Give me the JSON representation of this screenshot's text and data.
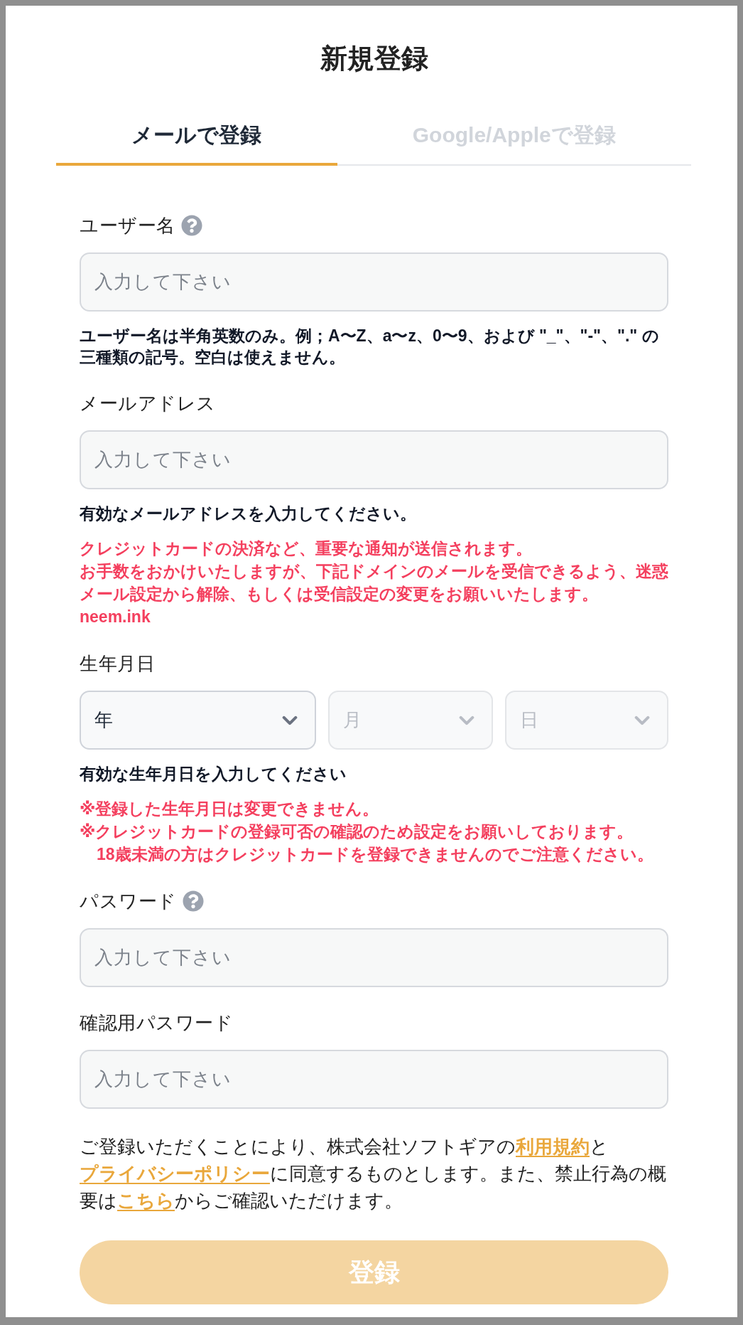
{
  "title": "新規登録",
  "tabs": [
    {
      "label": "メールで登録",
      "selected": true
    },
    {
      "label": "Google/Appleで登録",
      "selected": false
    }
  ],
  "form": {
    "fields": [
      {
        "kind": "text",
        "label": "ユーザー名",
        "help": true,
        "placeholder": "入力して下さい",
        "hint": "ユーザー名は半角英数のみ。例；A〜Z、a〜z、0〜9、および \"_\"、\"-\"、\".\" の三種類の記号。空白は使えません。"
      },
      {
        "kind": "text",
        "label": "メールアドレス",
        "help": false,
        "placeholder": "入力して下さい",
        "hint": "有効なメールアドレスを入力してください。",
        "notes": [
          {
            "text": "クレジットカードの決済など、重要な通知が送信されます。",
            "kind": "note"
          },
          {
            "text": "お手数をおかけいたしますが、下記ドメインのメールを受信できるよう、迷惑メール設定から解除、もしくは受信設定の変更をお願いいたします。",
            "kind": "note"
          },
          {
            "text": "neem.ink",
            "kind": "note"
          }
        ]
      },
      {
        "kind": "date",
        "label": "生年月日",
        "help": false,
        "selects": [
          {
            "value": "年",
            "disabled": false
          },
          {
            "value": "月",
            "disabled": true
          },
          {
            "value": "日",
            "disabled": true
          }
        ],
        "hint": "有効な生年月日を入力してください",
        "notes": [
          {
            "text": "※登録した生年月日は変更できません。",
            "kind": "note"
          },
          {
            "text": "※クレジットカードの登録可否の確認のため設定をお願いしております。",
            "kind": "note"
          },
          {
            "text": "18歳未満の方はクレジットカードを登録できませんのでご注意ください。",
            "kind": "continuation"
          }
        ]
      },
      {
        "kind": "text",
        "label": "パスワード",
        "help": true,
        "placeholder": "入力して下さい"
      },
      {
        "kind": "text",
        "label": "確認用パスワード",
        "help": false,
        "placeholder": "入力して下さい"
      }
    ]
  },
  "consent": [
    {
      "kind": "text",
      "text": "ご登録いただくことにより、株式会社ソフトギアの"
    },
    {
      "kind": "link",
      "text": "利用規約"
    },
    {
      "kind": "text",
      "text": "と"
    },
    {
      "kind": "link",
      "text": "プライバシーポリシー"
    },
    {
      "kind": "text",
      "text": "に同意するものとします。また、禁止行為の概要は"
    },
    {
      "kind": "link",
      "text": "こちら"
    },
    {
      "kind": "text",
      "text": "からご確認いただけます。"
    }
  ],
  "submit": {
    "label": "登録",
    "disabled": true
  }
}
